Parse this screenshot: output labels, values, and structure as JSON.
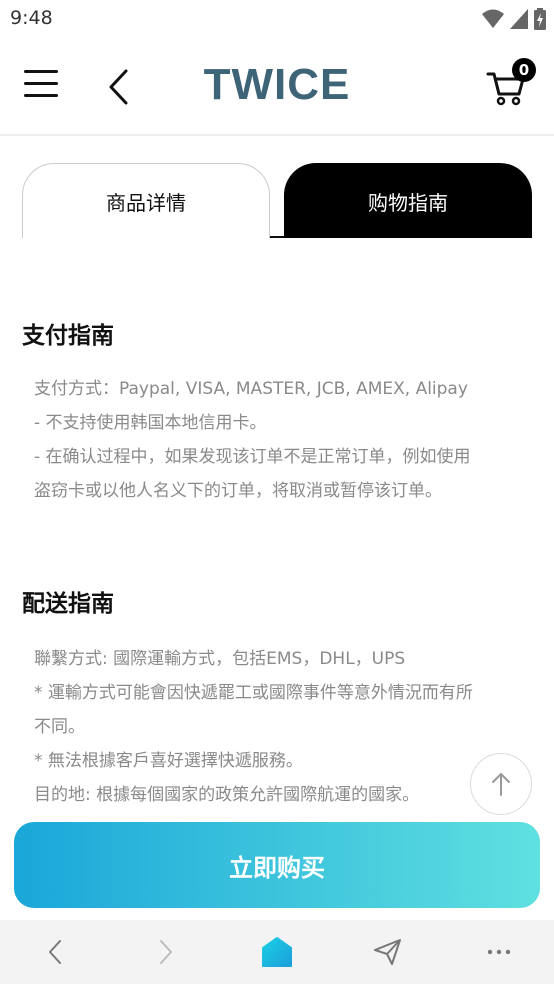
{
  "status": {
    "time": "9:48"
  },
  "header": {
    "brand": "TWICE",
    "cart_count": "0"
  },
  "tabs": [
    {
      "label": "商品详情",
      "active": false
    },
    {
      "label": "购物指南",
      "active": true
    }
  ],
  "payment": {
    "title": "支付指南",
    "lines": [
      "支付方式：Paypal, VISA, MASTER, JCB, AMEX, Alipay",
      "- 不支持使用韩国本地信用卡。",
      "- 在确认过程中，如果发现该订单不是正常订单，例如使用",
      "盗窃卡或以他人名义下的订单，将取消或暂停该订单。"
    ]
  },
  "shipping": {
    "title": "配送指南",
    "lines": [
      "聯繫方式: 國際運輸方式，包括EMS，DHL，UPS",
      "* 運輸方式可能會因快遞罷工或國際事件等意外情況而有所",
      "不同。",
      "* 無法根據客戶喜好選擇快遞服務。",
      "目的地: 根據每個國家的政策允許國際航運的國家。"
    ]
  },
  "buy_button": {
    "label": "立即购买"
  },
  "colors": {
    "brand": "#3e6478",
    "button_start": "#1aa7d9",
    "button_end": "#5fe0e0",
    "home_icon": "#1bb7dd"
  },
  "browser_bar": {
    "icons": [
      "back-icon",
      "forward-icon",
      "home-icon",
      "share-icon",
      "more-icon"
    ]
  }
}
